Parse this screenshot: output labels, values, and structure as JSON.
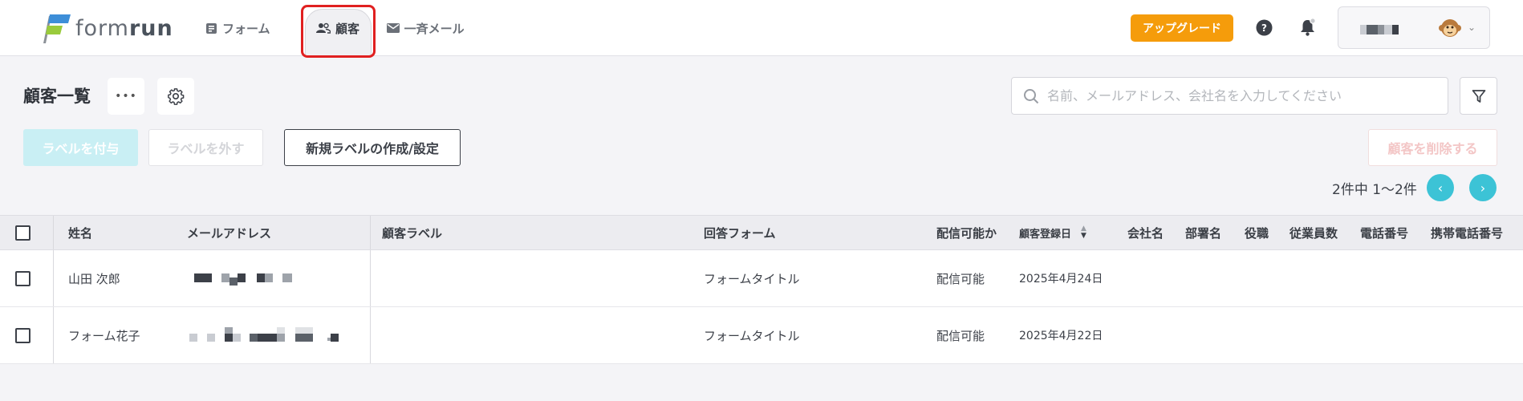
{
  "brand": {
    "logo_text_form": "form",
    "logo_text_run": "run",
    "primary_color": "#3cc3d6",
    "upgrade_color": "#f59c0b"
  },
  "nav": {
    "forms": {
      "label": "フォーム",
      "icon": "form-document-icon"
    },
    "customers": {
      "label": "顧客",
      "icon": "users-icon"
    },
    "bulk_mail": {
      "label": "一斉メール",
      "icon": "envelope-icon"
    }
  },
  "header": {
    "upgrade_label": "アップグレード"
  },
  "toolbar": {
    "title": "顧客一覧",
    "more_label": "•••",
    "search_placeholder": "名前、メールアドレス、会社名を入力してください",
    "add_label": "ラベルを付与",
    "remove_label": "ラベルを外す",
    "new_label": "新規ラベルの作成/設定",
    "delete_label": "顧客を削除する"
  },
  "pagination": {
    "text": "2件中 1〜2件",
    "prev": "‹",
    "next": "›"
  },
  "table": {
    "columns": {
      "name": "姓名",
      "email": "メールアドレス",
      "label": "顧客ラベル",
      "form": "回答フォーム",
      "deliverable": "配信可能か",
      "registered": "顧客登録日",
      "company": "会社名",
      "department": "部署名",
      "position": "役職",
      "employees": "従業員数",
      "phone": "電話番号",
      "mobile": "携帯電話番号"
    },
    "sort_up": "▲",
    "sort_down": "▼",
    "rows": [
      {
        "name": "山田 次郎",
        "form": "フォームタイトル",
        "deliverable": "配信可能",
        "registered": "2025年4月24日"
      },
      {
        "name": "フォーム花子",
        "form": "フォームタイトル",
        "deliverable": "配信可能",
        "registered": "2025年4月22日"
      }
    ]
  }
}
